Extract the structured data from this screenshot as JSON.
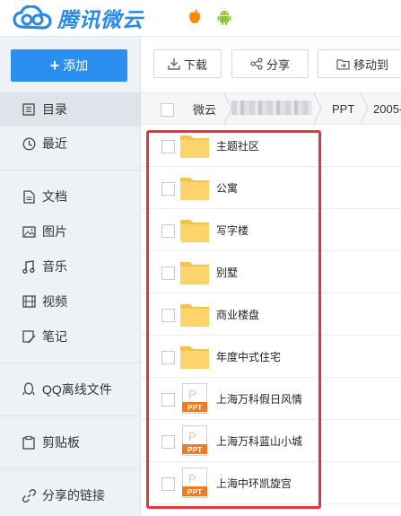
{
  "app": {
    "brand": "腾讯微云"
  },
  "colors": {
    "accent": "#2b8ff0",
    "highlight": "#e8323c",
    "folder": "#fbd56b",
    "ppt": "#f07b25"
  },
  "sidebar": {
    "add_label": "添加",
    "items": [
      {
        "label": "目录",
        "icon": "list-icon",
        "active": true
      },
      {
        "label": "最近",
        "icon": "clock-icon"
      },
      {
        "label": "文档",
        "icon": "document-icon"
      },
      {
        "label": "图片",
        "icon": "image-icon"
      },
      {
        "label": "音乐",
        "icon": "music-icon"
      },
      {
        "label": "视频",
        "icon": "video-icon"
      },
      {
        "label": "笔记",
        "icon": "note-icon"
      },
      {
        "label": "QQ离线文件",
        "icon": "qq-icon"
      },
      {
        "label": "剪贴板",
        "icon": "clipboard-icon"
      },
      {
        "label": "分享的链接",
        "icon": "link-icon"
      }
    ]
  },
  "toolbar": {
    "download": "下载",
    "share": "分享",
    "move": "移动到"
  },
  "breadcrumb": {
    "root": "微云",
    "folder": "PPT",
    "next": "2005-"
  },
  "files": [
    {
      "name": "主题社区",
      "type": "folder"
    },
    {
      "name": "公寓",
      "type": "folder"
    },
    {
      "name": "写字楼",
      "type": "folder"
    },
    {
      "name": "别墅",
      "type": "folder"
    },
    {
      "name": "商业楼盘",
      "type": "folder"
    },
    {
      "name": "年度中式住宅",
      "type": "folder"
    },
    {
      "name": "上海万科假日风情",
      "type": "ppt"
    },
    {
      "name": "上海万科蓝山小城",
      "type": "ppt"
    },
    {
      "name": "上海中环凯旋宫",
      "type": "ppt"
    }
  ],
  "ppt_badge": "PPT",
  "ppt_letter": "P"
}
